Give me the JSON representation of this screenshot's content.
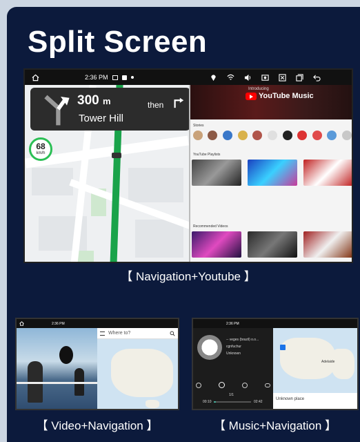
{
  "title": "Split Screen",
  "colors": {
    "card_bg": "#0c1a3c",
    "route_green": "#1aa34a",
    "youtube_red": "#ff0000",
    "speed_ring": "#2bbf55"
  },
  "main": {
    "status": {
      "time": "2:36 PM"
    },
    "nav": {
      "distance": "300",
      "distance_unit": "m",
      "street": "Tower Hill",
      "then": "then"
    },
    "speed": {
      "value": "68",
      "unit": "km/h"
    },
    "youtube": {
      "intro": "Introducing",
      "brand": "YouTube Music",
      "section_stories": "Stories",
      "section_playlists": "YouTube Playlists",
      "section_recommended": "Recommended Videos"
    },
    "caption": "【 Navigation+Youtube 】"
  },
  "video_nav": {
    "status_time": "2:36 PM",
    "search_placeholder": "Where to?",
    "caption": "【 Video+Navigation 】"
  },
  "music_nav": {
    "status_time": "2:36 PM",
    "track_title": "-- veges (brazil) o.o...",
    "artist": "cgnfuchur",
    "album": "Unknown",
    "track_index": "1/1",
    "time_elapsed": "00:10",
    "time_total": "02:42",
    "map_label": "Adelaide",
    "place": "Unknown place",
    "caption": "【 Music+Navigation 】"
  },
  "icons": [
    "home-icon",
    "turn-left-arrow-icon",
    "turn-right-arrow-icon",
    "wifi-icon",
    "volume-icon",
    "back-icon",
    "play-icon",
    "repeat-icon"
  ]
}
